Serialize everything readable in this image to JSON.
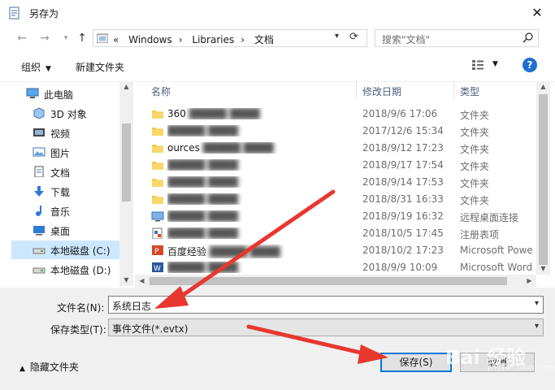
{
  "dialog": {
    "title": "另存为"
  },
  "address": {
    "crumbs": [
      "Windows",
      "Libraries",
      "文档"
    ],
    "prefix": "«"
  },
  "search": {
    "placeholder": "搜索\"文档\""
  },
  "toolbar": {
    "organize": "组织",
    "new_folder": "新建文件夹",
    "help": "?"
  },
  "sidebar": {
    "items": [
      {
        "label": "此电脑",
        "icon": "computer-icon"
      },
      {
        "label": "3D 对象",
        "icon": "3d-objects-icon"
      },
      {
        "label": "视频",
        "icon": "video-icon"
      },
      {
        "label": "图片",
        "icon": "pictures-icon"
      },
      {
        "label": "文档",
        "icon": "documents-icon"
      },
      {
        "label": "下载",
        "icon": "download-icon"
      },
      {
        "label": "音乐",
        "icon": "music-icon"
      },
      {
        "label": "桌面",
        "icon": "desktop-icon"
      },
      {
        "label": "本地磁盘 (C:)",
        "icon": "drive-icon",
        "selected": true
      },
      {
        "label": "本地磁盘 (D:)",
        "icon": "drive-icon"
      }
    ]
  },
  "files": {
    "columns": {
      "name": "名称",
      "date": "修改日期",
      "type": "类型"
    },
    "rows": [
      {
        "name": "360",
        "date": "2018/9/6 17:06",
        "type": "文件夹",
        "icon": "folder-icon"
      },
      {
        "name": "",
        "date": "2017/12/6 15:34",
        "type": "文件夹",
        "icon": "folder-icon"
      },
      {
        "name": "ources",
        "date": "2018/9/12 17:23",
        "type": "文件夹",
        "icon": "folder-icon"
      },
      {
        "name": "",
        "date": "2018/9/17 17:54",
        "type": "文件夹",
        "icon": "folder-icon"
      },
      {
        "name": "",
        "date": "2018/9/14 17:53",
        "type": "文件夹",
        "icon": "folder-icon"
      },
      {
        "name": "",
        "date": "2018/8/31 16:33",
        "type": "文件夹",
        "icon": "folder-icon"
      },
      {
        "name": "",
        "date": "2018/9/19 16:32",
        "type": "远程桌面连接",
        "icon": "remote-desktop-icon"
      },
      {
        "name": "",
        "date": "2018/10/5 17:45",
        "type": "注册表项",
        "icon": "registry-icon"
      },
      {
        "name": "百度经验",
        "date": "2018/10/2 17:23",
        "type": "Microsoft Powe",
        "icon": "powerpoint-icon"
      },
      {
        "name": "",
        "date": "2018/9/9 10:09",
        "type": "Microsoft Word",
        "icon": "word-icon"
      }
    ]
  },
  "form": {
    "filename_label": "文件名(N):",
    "filename_value": "系统日志",
    "filetype_label": "保存类型(T):",
    "filetype_value": "事件文件(*.evtx)",
    "hide_folders": "隐藏文件夹",
    "save": "保存(S)",
    "cancel": "取消"
  },
  "watermark": {
    "text": "Bai 经验",
    "sub": "jingyan.baidu.com"
  },
  "colors": {
    "accent": "#0078d7",
    "arrow": "#e8372f",
    "folder": "#f5c94c",
    "selection": "#cce8ff"
  }
}
